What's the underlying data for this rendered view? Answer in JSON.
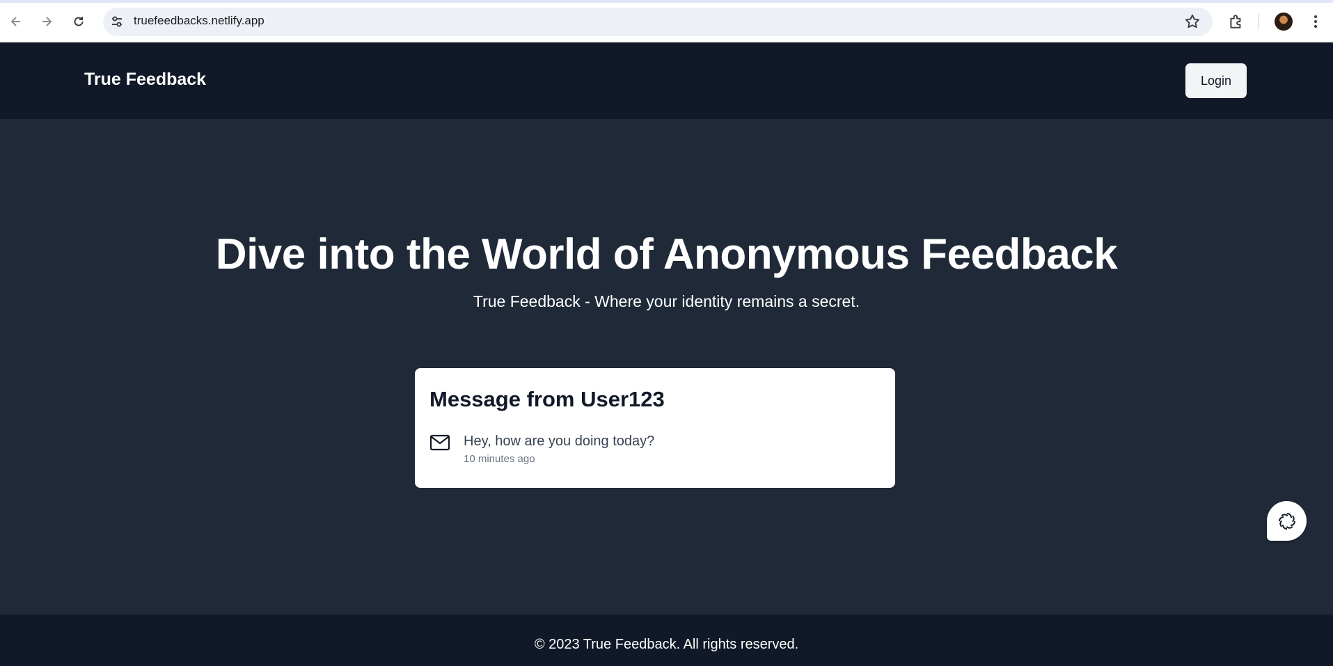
{
  "browser": {
    "url": "truefeedbacks.netlify.app",
    "icons": [
      "back-arrow-icon",
      "forward-arrow-icon",
      "reload-icon",
      "site-controls-icon",
      "bookmark-star-icon",
      "extensions-puzzle-icon",
      "profile-avatar",
      "more-menu-icon"
    ]
  },
  "header": {
    "brand": "True Feedback",
    "login_label": "Login"
  },
  "hero": {
    "title": "Dive into the World of Anonymous Feedback",
    "subtitle": "True Feedback - Where your identity remains a secret."
  },
  "message_card": {
    "title": "Message from User123",
    "icon": "mail-icon",
    "text": "Hey, how are you doing today?",
    "time": "10 minutes ago"
  },
  "footer": {
    "text": "© 2023 True Feedback. All rights reserved."
  },
  "colors": {
    "header_bg": "#111827",
    "main_bg": "#1f2937",
    "card_bg": "#ffffff",
    "login_bg": "#f3f4f6"
  }
}
